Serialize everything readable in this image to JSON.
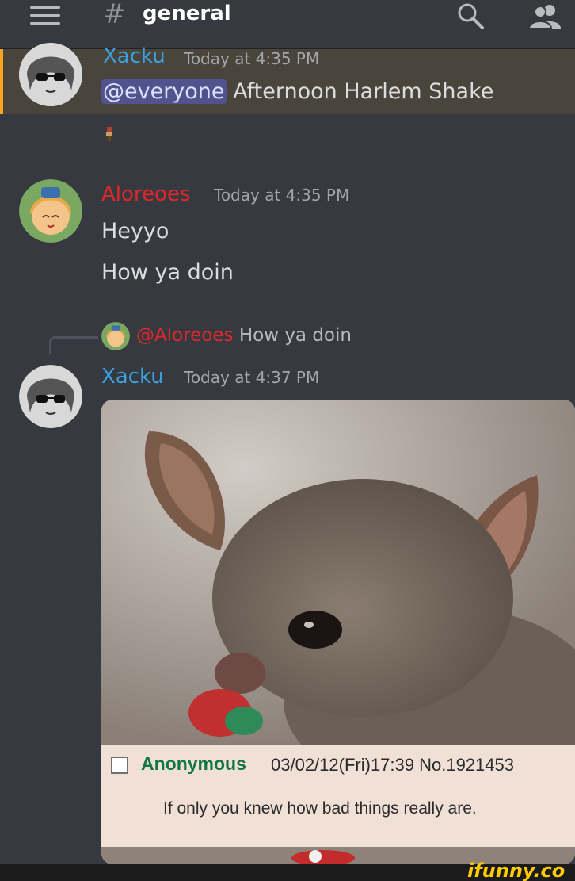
{
  "header": {
    "channel_hash": "#",
    "channel_name": "general",
    "icons": [
      "menu-icon",
      "search-icon",
      "members-icon"
    ]
  },
  "messages": [
    {
      "author": "Xacku",
      "author_color": "#3ba1e0",
      "timestamp": "Today at 4:35 PM",
      "mention": "@everyone",
      "text": " Afternoon Harlem Shake",
      "highlighted": true
    },
    {
      "author": "Aloreoes",
      "author_color": "#e0282a",
      "timestamp": "Today at 4:35 PM",
      "lines": [
        "Heyyo",
        "How ya doin"
      ]
    },
    {
      "reply_to": {
        "mention": "@Aloreoes",
        "mention_color": "#e0282a",
        "text": "How ya doin"
      },
      "author": "Xacku",
      "author_color": "#3ba1e0",
      "timestamp": "Today at 4:37 PM",
      "attachment": {
        "caption_name": "Anonymous",
        "caption_meta": "03/02/12(Fri)17:39 No.1921453",
        "caption_text": "If only you knew how bad things really are."
      }
    }
  ],
  "watermark": "ifunny.co"
}
